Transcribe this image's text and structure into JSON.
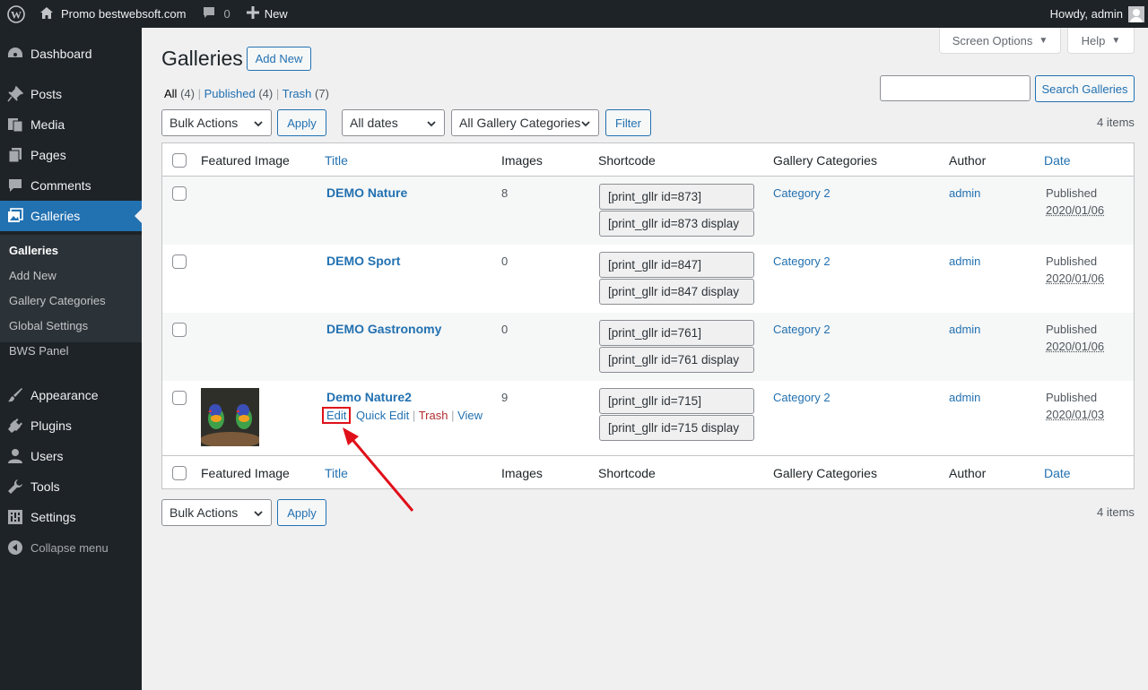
{
  "admin_bar": {
    "site_name": "Promo bestwebsoft.com",
    "comments_count": "0",
    "new_label": "New",
    "greeting": "Howdy, admin"
  },
  "sidebar": {
    "items": [
      {
        "label": "Dashboard",
        "icon": "dashboard-icon"
      },
      {
        "label": "Posts",
        "icon": "pin-icon"
      },
      {
        "label": "Media",
        "icon": "media-icon"
      },
      {
        "label": "Pages",
        "icon": "pages-icon"
      },
      {
        "label": "Comments",
        "icon": "comment-icon"
      },
      {
        "label": "Galleries",
        "icon": "gallery-icon"
      },
      {
        "label": "Appearance",
        "icon": "brush-icon"
      },
      {
        "label": "Plugins",
        "icon": "plug-icon"
      },
      {
        "label": "Users",
        "icon": "user-icon"
      },
      {
        "label": "Tools",
        "icon": "wrench-icon"
      },
      {
        "label": "Settings",
        "icon": "settings-icon"
      }
    ],
    "submenu": [
      "Galleries",
      "Add New",
      "Gallery Categories",
      "Global Settings",
      "BWS Panel"
    ],
    "collapse_label": "Collapse menu"
  },
  "screen_options": "Screen Options",
  "help": "Help",
  "page_title": "Galleries",
  "add_new": "Add New",
  "filters_links": {
    "all": "All",
    "all_count": "(4)",
    "published": "Published",
    "published_count": "(4)",
    "trash": "Trash",
    "trash_count": "(7)"
  },
  "search": {
    "value": "",
    "button": "Search Galleries"
  },
  "toolbar": {
    "bulk_actions": "Bulk Actions",
    "apply": "Apply",
    "dates": "All dates",
    "categories": "All Gallery Categories",
    "filter": "Filter",
    "items_count": "4 items"
  },
  "columns": [
    "Featured Image",
    "Title",
    "Images",
    "Shortcode",
    "Gallery Categories",
    "Author",
    "Date"
  ],
  "rows": [
    {
      "title": "DEMO Nature",
      "images": "8",
      "shortcode1": "[print_gllr id=873]",
      "shortcode2": "[print_gllr id=873 display",
      "category": "Category 2",
      "author": "admin",
      "status": "Published",
      "date": "2020/01/06"
    },
    {
      "title": "DEMO Sport",
      "images": "0",
      "shortcode1": "[print_gllr id=847]",
      "shortcode2": "[print_gllr id=847 display",
      "category": "Category 2",
      "author": "admin",
      "status": "Published",
      "date": "2020/01/06"
    },
    {
      "title": "DEMO Gastronomy",
      "images": "0",
      "shortcode1": "[print_gllr id=761]",
      "shortcode2": "[print_gllr id=761 display",
      "category": "Category 2",
      "author": "admin",
      "status": "Published",
      "date": "2020/01/06"
    },
    {
      "title": "Demo Nature2",
      "images": "9",
      "shortcode1": "[print_gllr id=715]",
      "shortcode2": "[print_gllr id=715 display",
      "category": "Category 2",
      "author": "admin",
      "status": "Published",
      "date": "2020/01/03"
    }
  ],
  "row_actions": {
    "edit": "Edit",
    "quick_edit": "Quick Edit",
    "trash": "Trash",
    "view": "View"
  },
  "colors": {
    "accent": "#2271b1",
    "admin_bar": "#1d2327",
    "highlight": "#e0101a"
  }
}
